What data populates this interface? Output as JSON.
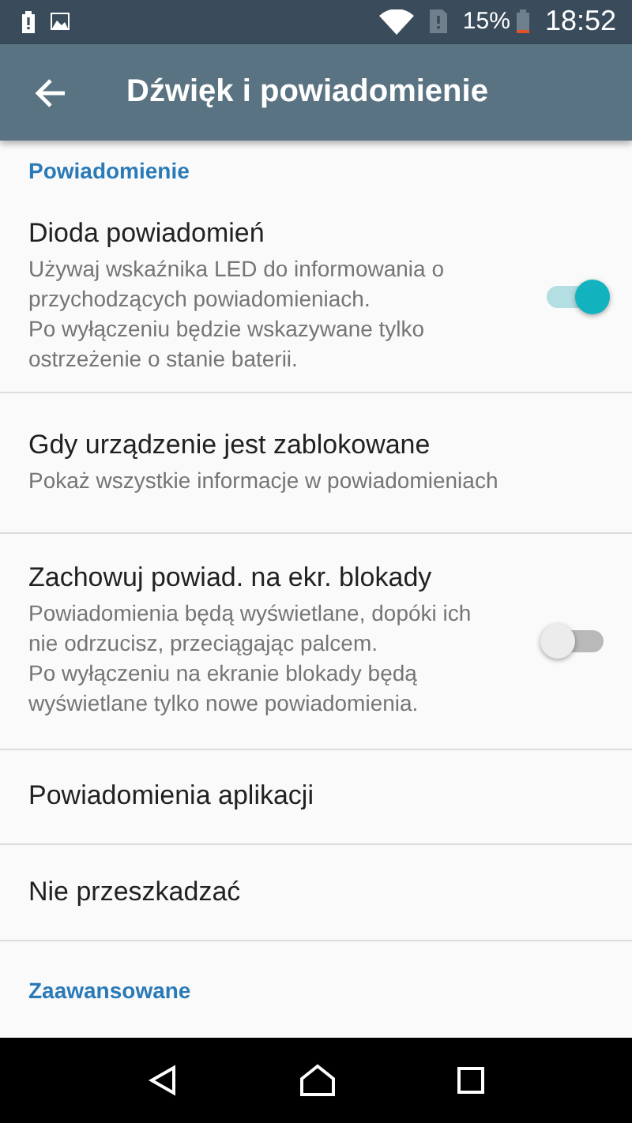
{
  "status_bar": {
    "battery_percent": "15%",
    "time": "18:52"
  },
  "app_bar": {
    "title": "Dźwięk i powiadomienie"
  },
  "items": [
    {
      "kind": "header",
      "title": "Powiadomienie"
    },
    {
      "kind": "switch",
      "title": "Dioda powiadomień",
      "summary": "Używaj wskaźnika LED do informowania o przychodzących powiadomieniach.\nPo wyłączeniu będzie wskazywane tylko ostrzeżenie o stanie baterii.",
      "on": true
    },
    {
      "kind": "text",
      "title": "Gdy urządzenie jest zablokowane",
      "summary": "Pokaż wszystkie informacje w powiadomieniach"
    },
    {
      "kind": "switch",
      "title": "Zachowuj powiad. na ekr. blokady",
      "summary": "Powiadomienia będą wyświetlane, dopóki ich nie odrzucisz, przeciągając palcem.\nPo wyłączeniu na ekranie blokady będą wyświetlane tylko nowe powiadomienia.",
      "on": false
    },
    {
      "kind": "text",
      "title": "Powiadomienia aplikacji"
    },
    {
      "kind": "text",
      "title": "Nie przeszkadzać"
    },
    {
      "kind": "header",
      "title": "Zaawansowane"
    }
  ]
}
